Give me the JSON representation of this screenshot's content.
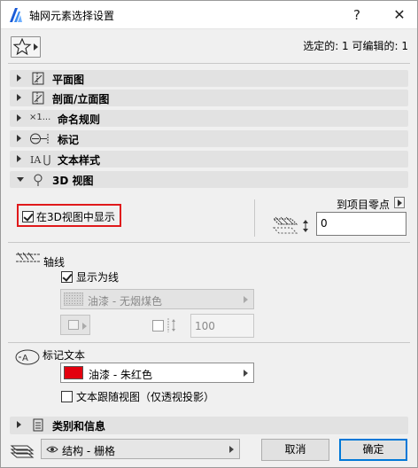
{
  "window": {
    "title": "轴网元素选择设置",
    "help": "?",
    "close": "✕"
  },
  "selection_info": "选定的: 1 可编辑的: 1",
  "panels": [
    {
      "label": "平面图",
      "icon": "floor-plan-icon"
    },
    {
      "label": "剖面/立面图",
      "icon": "section-elevation-icon"
    },
    {
      "label": "命名规则",
      "icon": "naming-rule-icon",
      "icon_text": "×1..."
    },
    {
      "label": "标记",
      "icon": "marker-icon"
    },
    {
      "label": "文本样式",
      "icon": "text-style-icon"
    },
    {
      "label": "3D 视图",
      "icon": "3d-view-icon"
    }
  ],
  "view3d": {
    "show_in_3d": {
      "label": "在3D视图中显示",
      "checked": true
    },
    "to_project_zero": "到项目零点",
    "elevation_value": "0"
  },
  "gridline": {
    "section_label": "轴线",
    "show_as_line": {
      "label": "显示为线",
      "checked": true
    },
    "surface_material": "油漆 - 无烟煤色",
    "thickness_value": "100"
  },
  "marker_text": {
    "section_label": "标记文本",
    "material": "油漆 - 朱红色",
    "material_color": "#e3000f",
    "follow_view": {
      "label": "文本跟随视图（仅透视投影）",
      "checked": false
    }
  },
  "category_panel": {
    "label": "类别和信息"
  },
  "footer": {
    "layer_value": "结构 - 栅格",
    "cancel": "取消",
    "ok": "确定"
  }
}
